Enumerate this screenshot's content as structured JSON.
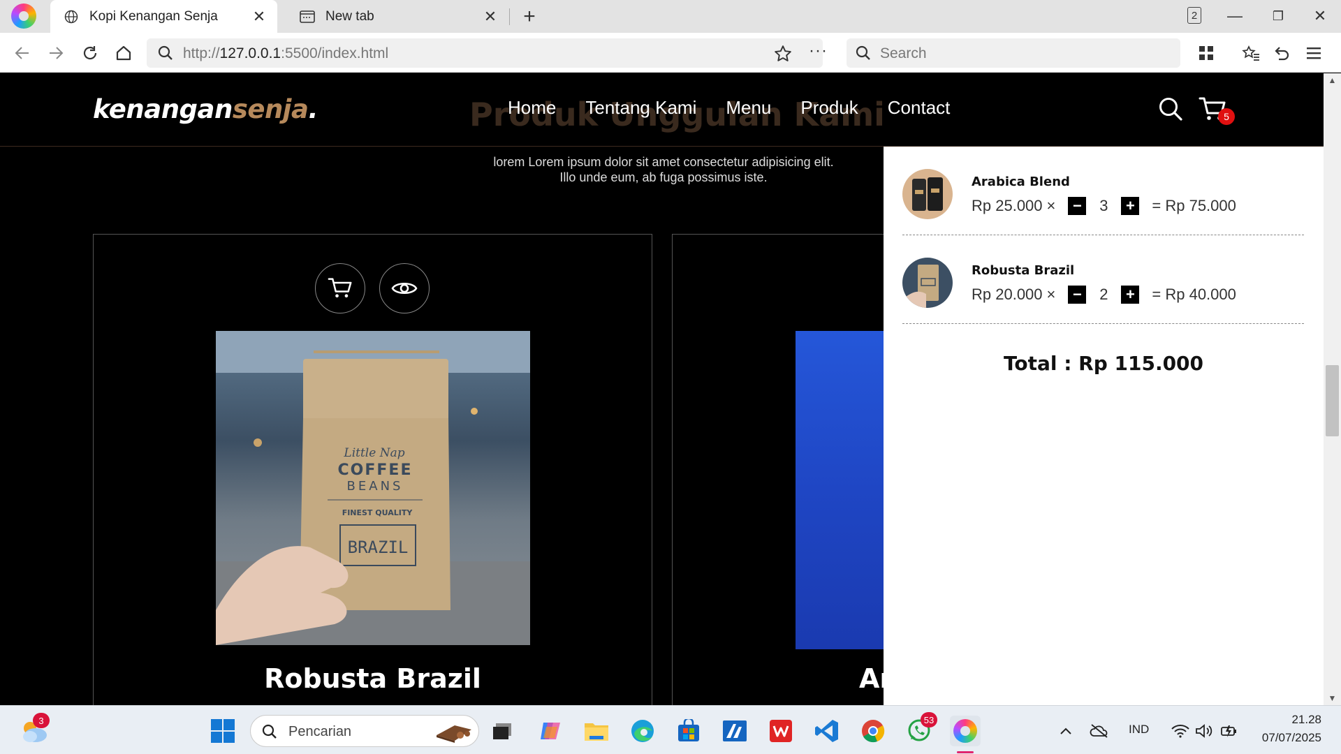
{
  "browser": {
    "tabs": [
      {
        "title": "Kopi Kenangan Senja",
        "active": true
      },
      {
        "title": "New tab",
        "active": false
      }
    ],
    "tab_count": "2",
    "url_dim_prefix": "http://",
    "url_host": "127.0.0.1",
    "url_rest": ":5500/index.html",
    "search_placeholder": "Search"
  },
  "site": {
    "brand_main": "kenangan",
    "brand_accent": "senja",
    "brand_dot": ".",
    "nav": [
      "Home",
      "Tentang Kami",
      "Menu",
      "Produk",
      "Contact"
    ],
    "cart_count": "5",
    "section_title": "Produk Unggulan Kami",
    "section_subtitle_1": "lorem Lorem ipsum dolor sit amet consectetur adipisicing elit.",
    "section_subtitle_2": "Illo unde eum, ab fuga possimus iste.",
    "products": [
      {
        "name": "Robusta Brazil",
        "bag_brand": "Little Nap",
        "bag_line1": "COFFEE",
        "bag_line2": "BEANS",
        "bag_quality": "FINEST QUALITY",
        "bag_origin": "BRAZIL"
      },
      {
        "name": "Ar"
      }
    ],
    "colors": {
      "accent": "#b6895b",
      "badge": "#e01010"
    }
  },
  "cart": {
    "items": [
      {
        "name": "Arabica Blend",
        "price": "Rp 25.000",
        "times": "×",
        "minus": "−",
        "qty": "3",
        "plus": "+",
        "subtotal": "= Rp 75.000"
      },
      {
        "name": "Robusta Brazil",
        "price": "Rp 20.000",
        "times": "×",
        "minus": "−",
        "qty": "2",
        "plus": "+",
        "subtotal": "= Rp 40.000"
      }
    ],
    "total": "Total : Rp 115.000"
  },
  "taskbar": {
    "weather_badge": "3",
    "search_placeholder": "Pencarian",
    "whatsapp_badge": "53",
    "language": "IND",
    "time": "21.28",
    "date": "07/07/2025"
  }
}
